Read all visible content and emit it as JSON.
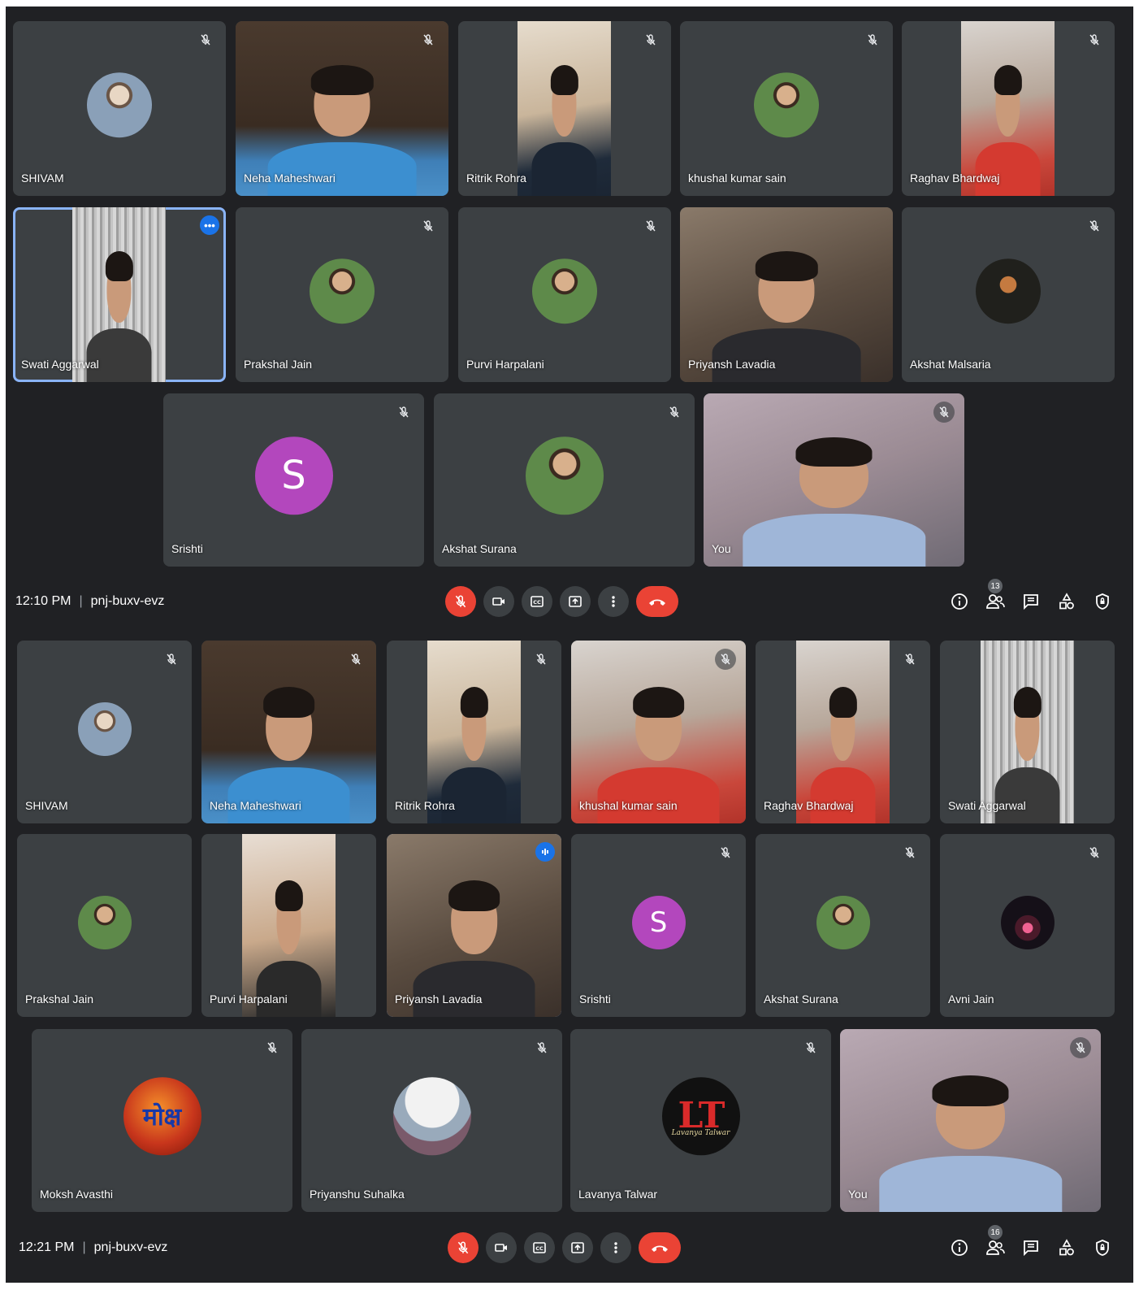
{
  "colors": {
    "background": "#202124",
    "tile": "#3c4043",
    "active_border": "#8ab4f8",
    "end_call": "#ea4335",
    "avatar_letter_bg": "#b347bd",
    "badge_blue": "#1a73e8"
  },
  "screen_a": {
    "tiles": [
      {
        "name": "SHIVAM",
        "kind": "avatar",
        "muted": true
      },
      {
        "name": "Neha Maheshwari",
        "kind": "video",
        "muted": true
      },
      {
        "name": "Ritrik Rohra",
        "kind": "video",
        "muted": true
      },
      {
        "name": "khushal kumar sain",
        "kind": "avatar",
        "muted": true
      },
      {
        "name": "Raghav Bhardwaj",
        "kind": "video",
        "muted": true
      },
      {
        "name": "Swati Aggarwal",
        "kind": "video",
        "active": true,
        "badge": "more-options-icon"
      },
      {
        "name": "Prakshal Jain",
        "kind": "avatar",
        "muted": true
      },
      {
        "name": "Purvi Harpalani",
        "kind": "avatar",
        "muted": true
      },
      {
        "name": "Priyansh Lavadia",
        "kind": "video"
      },
      {
        "name": "Akshat Malsaria",
        "kind": "avatar",
        "muted": true
      },
      {
        "name": "Srishti",
        "kind": "letter",
        "letter": "S",
        "muted": true
      },
      {
        "name": "Akshat Surana",
        "kind": "avatar",
        "muted": true
      },
      {
        "name": "You",
        "kind": "video",
        "muted": true
      }
    ],
    "bar": {
      "time": "12:10 PM",
      "separator": "|",
      "meeting_code": "pnj-buxv-evz",
      "participants_count": "13"
    }
  },
  "screen_b": {
    "tiles": [
      {
        "name": "SHIVAM",
        "kind": "avatar",
        "muted": true
      },
      {
        "name": "Neha Maheshwari",
        "kind": "video",
        "muted": true
      },
      {
        "name": "Ritrik Rohra",
        "kind": "video",
        "muted": true
      },
      {
        "name": "khushal kumar sain",
        "kind": "video",
        "muted": true
      },
      {
        "name": "Raghav Bhardwaj",
        "kind": "video",
        "muted": true
      },
      {
        "name": "Swati Aggarwal",
        "kind": "video"
      },
      {
        "name": "Prakshal Jain",
        "kind": "avatar"
      },
      {
        "name": "Purvi Harpalani",
        "kind": "video"
      },
      {
        "name": "Priyansh Lavadia",
        "kind": "video",
        "active": true,
        "badge": "speaking-icon"
      },
      {
        "name": "Srishti",
        "kind": "letter",
        "letter": "S",
        "muted": true
      },
      {
        "name": "Akshat Surana",
        "kind": "avatar",
        "muted": true
      },
      {
        "name": "Avni Jain",
        "kind": "avatar",
        "muted": true
      },
      {
        "name": "Moksh Avasthi",
        "kind": "logo",
        "logo_text": "मोक्ष",
        "muted": true
      },
      {
        "name": "Priyanshu Suhalka",
        "kind": "avatar",
        "muted": true
      },
      {
        "name": "Lavanya Talwar",
        "kind": "logo",
        "logo_text": "LT",
        "logo_subtext": "Lavanya Talwar",
        "muted": true
      },
      {
        "name": "You",
        "kind": "video",
        "muted": true
      }
    ],
    "bar": {
      "time": "12:21 PM",
      "separator": "|",
      "meeting_code": "pnj-buxv-evz",
      "participants_count": "16"
    }
  },
  "controls": [
    {
      "icon": "mic-off-icon",
      "state": "off"
    },
    {
      "icon": "camera-icon"
    },
    {
      "icon": "closed-captions-icon"
    },
    {
      "icon": "present-screen-icon"
    },
    {
      "icon": "more-options-icon"
    },
    {
      "icon": "end-call-icon"
    }
  ],
  "right_icons": [
    "info-icon",
    "people-icon",
    "chat-icon",
    "activities-icon",
    "host-controls-icon"
  ]
}
